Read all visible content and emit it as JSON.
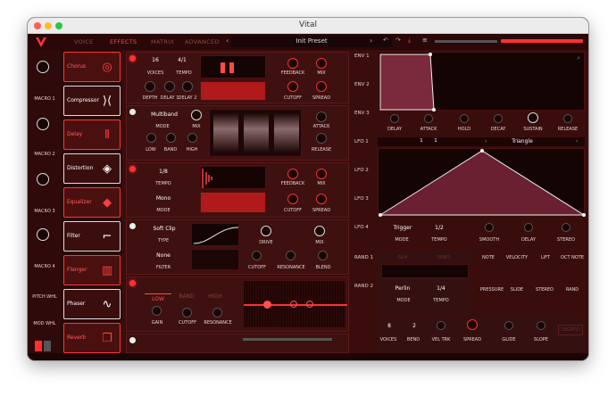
{
  "window": {
    "title": "Vital"
  },
  "tabs": [
    {
      "label": "VOICE"
    },
    {
      "label": "EFFECTS"
    },
    {
      "label": "MATRIX"
    },
    {
      "label": "ADVANCED"
    }
  ],
  "preset": {
    "name": "Init Preset"
  },
  "macros": [
    "MACRO 1",
    "MACRO 2",
    "MACRO 3",
    "MACRO 4",
    "PITCH WHL",
    "MOD WHL"
  ],
  "effects": [
    "Chorus",
    "Compressor",
    "Delay",
    "Distortion",
    "Equalizer",
    "Filter",
    "Flanger",
    "Phaser",
    "Reverb"
  ],
  "chorus": {
    "voices_val": "16",
    "tempo_val": "4/1",
    "voices": "VOICES",
    "tempo": "TEMPO",
    "feedback": "FEEDBACK",
    "mix": "MIX",
    "depth": "DEPTH",
    "delay1": "DELAY 1",
    "delay2": "DELAY 2",
    "cutoff": "CUTOFF",
    "spread": "SPREAD"
  },
  "compressor": {
    "mode_val": "Multiband",
    "mode": "MODE",
    "mix": "MIX",
    "low": "LOW",
    "band": "BAND",
    "high": "HIGH",
    "attack": "ATTACK",
    "release": "RELEASE"
  },
  "delay": {
    "tempo_val": "1/8",
    "tempo": "TEMPO",
    "mode_val": "Mono",
    "mode": "MODE",
    "feedback": "FEEDBACK",
    "mix": "MIX",
    "cutoff": "CUTOFF",
    "spread": "SPREAD"
  },
  "distortion": {
    "type_val": "Soft Clip",
    "type": "TYPE",
    "filter_val": "None",
    "filter": "FILTER",
    "drive": "DRIVE",
    "mix": "MIX",
    "cutoff": "CUTOFF",
    "resonance": "RESONANCE",
    "blend": "BLEND"
  },
  "eq": {
    "low": "LOW",
    "band": "BAND",
    "high": "HIGH",
    "gain": "GAIN",
    "cutoff": "CUTOFF",
    "resonance": "RESONANCE"
  },
  "env": {
    "labels": [
      "ENV 1",
      "ENV 2",
      "ENV 3"
    ],
    "delay": "DELAY",
    "attack": "ATTACK",
    "hold": "HOLD",
    "decay": "DECAY",
    "sustain": "SUSTAIN",
    "release": "RELEASE"
  },
  "lfo": {
    "labels": [
      "LFO 1",
      "LFO 2",
      "LFO 3",
      "LFO 4"
    ],
    "num1": "1",
    "num2": "1",
    "shape": "Triangle",
    "mode_val": "Trigger",
    "mode": "MODE",
    "tempo_val": "1/2",
    "tempo": "TEMPO",
    "smooth": "SMOOTH",
    "delay": "DELAY",
    "stereo": "STEREO"
  },
  "rand": {
    "labels": [
      "RAND 1",
      "RAND 2"
    ],
    "sh": "S&H",
    "sines": "SINES",
    "type_val": "Perlin",
    "mode": "MODE",
    "tempo_val": "1/4",
    "tempo": "TEMPO"
  },
  "mods": [
    "NOTE",
    "VELOCITY",
    "LIFT",
    "OCT NOTE",
    "PRESSURE",
    "SLIDE",
    "STEREO",
    "RAND"
  ],
  "voice": {
    "voices_val": "8",
    "voices": "VOICES",
    "bend_val": "2",
    "bend": "BEND",
    "veltrk": "VEL TRK",
    "spread": "SPREAD",
    "glide": "GLIDE",
    "slope": "SLOPE",
    "legato": "LEGATO"
  }
}
